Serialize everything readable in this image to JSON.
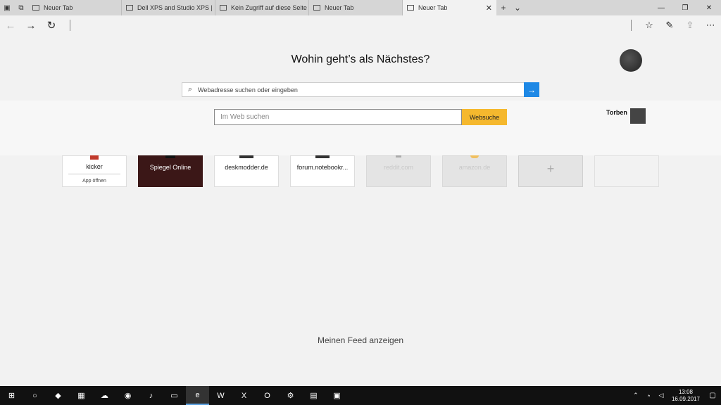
{
  "tabs": [
    {
      "label": "Neuer Tab"
    },
    {
      "label": "Dell XPS and Studio XPS | N"
    },
    {
      "label": "Kein Zugriff auf diese Seite"
    },
    {
      "label": "Neuer Tab"
    },
    {
      "label": "Neuer Tab",
      "active": true
    }
  ],
  "icons": {
    "tab_preview": "tab-preview-icon",
    "set_aside": "set-aside-icon",
    "back": "back-arrow-icon",
    "forward": "forward-arrow-icon",
    "refresh": "refresh-icon",
    "favorites": "favorites-icon",
    "notes": "web-note-icon",
    "share": "share-icon"
  },
  "newtab": {
    "title": "Wohin geht’s als Nächstes?",
    "search_placeholder": "Webadresse suchen oder eingeben",
    "web_search_placeholder": "Im Web suchen",
    "web_search_button": "Websuche",
    "user_name": "Torben",
    "feed_link": "Meinen Feed anzeigen"
  },
  "tiles": [
    {
      "label": "kicker",
      "sub": "App öffnen"
    },
    {
      "label": "Spiegel Online"
    },
    {
      "label": "deskmodder.de"
    },
    {
      "label": "forum.notebookr..."
    },
    {
      "label": "reddit.com"
    },
    {
      "label": "amazon.de"
    }
  ],
  "taskbar": {
    "time": "13:08",
    "date": "16.09.2017"
  },
  "colors": {
    "accent": "#1e88e5",
    "websuche": "#f5b82e",
    "spiegel_tile": "#3b1717"
  }
}
